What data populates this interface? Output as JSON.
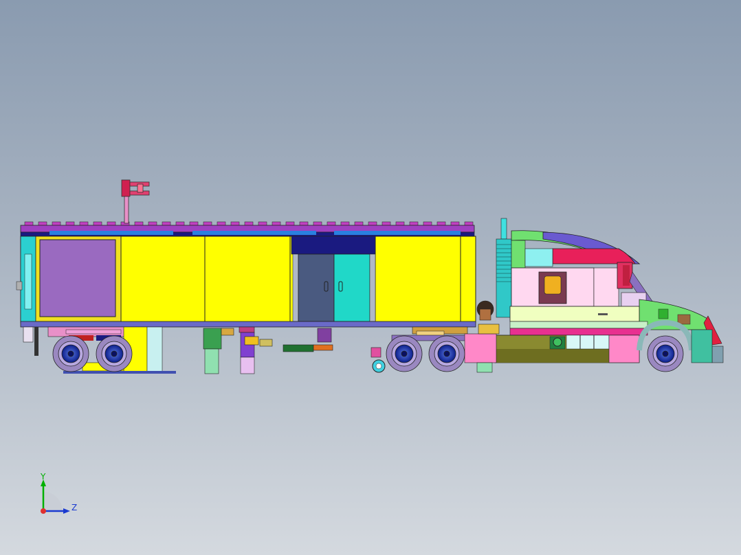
{
  "viewport": {
    "background_top": "#8a9bb0",
    "background_bottom": "#d4d9df"
  },
  "model": {
    "description_visible": false,
    "trailer_body_color": "#ffff00",
    "trailer_roof_color": "#a040c0",
    "tractor_cab_color": "#ff66cc",
    "wheel_color": "#1a3aa8",
    "tire_color": "#9a88c0"
  },
  "triad": {
    "y_label": "Y",
    "z_label": "Z",
    "y_color": "#00b000",
    "z_color": "#1a3ad0",
    "origin_color": "#e03030"
  }
}
